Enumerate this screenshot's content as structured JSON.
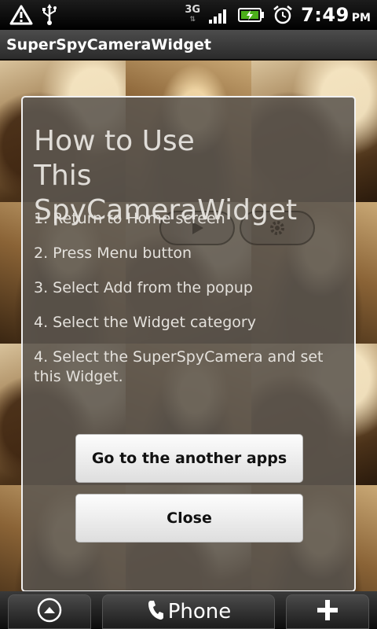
{
  "status_bar": {
    "network_type": "3G",
    "time": "7:49",
    "ampm": "PM",
    "icons": [
      "alert-icon",
      "usb-icon",
      "signal-icon",
      "battery-charging-icon",
      "alarm-icon"
    ]
  },
  "app": {
    "title": "SuperSpyCameraWidget"
  },
  "dialog": {
    "title_line1": "How to Use",
    "title_line2": "This SpyCameraWidget",
    "steps": [
      "1. Return to Home screen",
      "2. Press Menu button",
      "3. Select Add from the popup",
      "4. Select the Widget category",
      "4. Select the SuperSpyCamera and set this Widget."
    ],
    "buttons": {
      "other_apps": "Go to the another apps",
      "close": "Close"
    }
  },
  "dock": {
    "phone_label": "Phone",
    "icons": [
      "launcher-up-icon",
      "phone-icon",
      "add-icon"
    ]
  },
  "colors": {
    "dialog_border": "#f2f2f2",
    "dialog_bg": "#5c5750",
    "button_bg": "#f5f5f5"
  }
}
